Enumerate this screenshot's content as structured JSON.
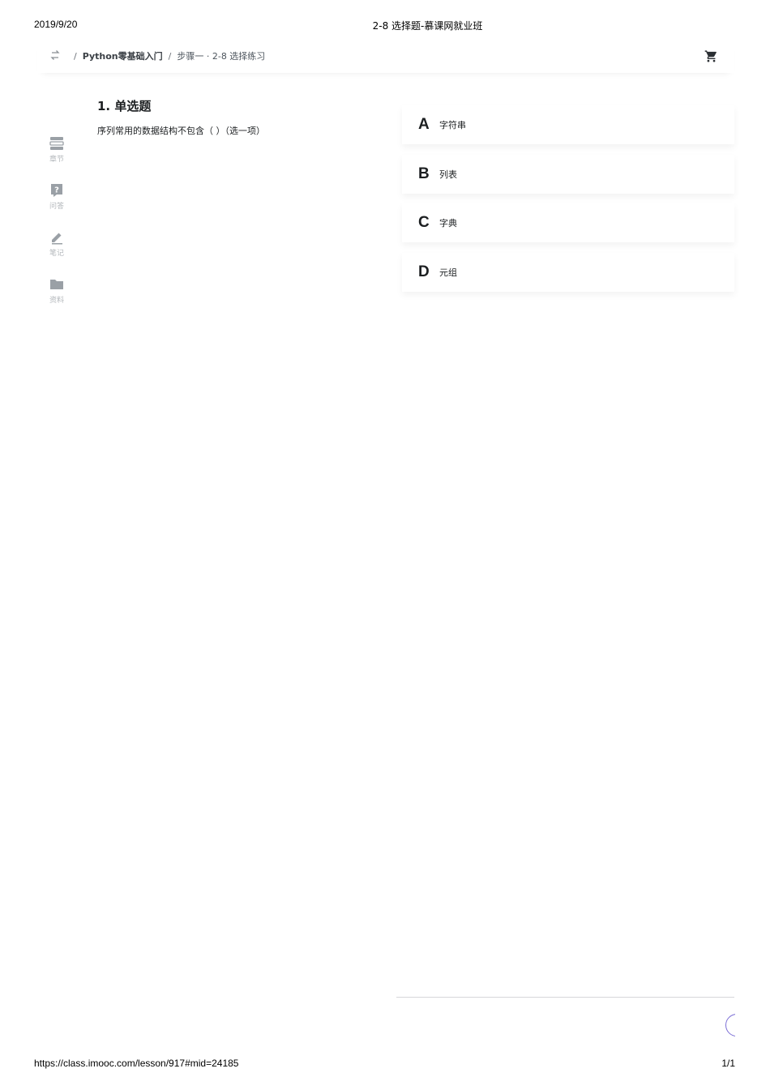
{
  "print": {
    "date": "2019/9/20",
    "title": "2-8 选择题-慕课网就业班",
    "url": "https://class.imooc.com/lesson/917#mid=24185",
    "page": "1/1"
  },
  "topbar": {
    "back_icon": "switch-arrows-icon",
    "breadcrumb": {
      "sep1": "/",
      "course": "Python零基础入门",
      "sep2": "/",
      "lesson": "步骤一 · 2-8 选择练习"
    },
    "cart_icon": "shopping-cart-icon"
  },
  "sidebar": {
    "items": [
      {
        "icon": "chapter-list-icon",
        "label": "章节"
      },
      {
        "icon": "question-icon",
        "label": "问答"
      },
      {
        "icon": "pencil-icon",
        "label": "笔记"
      },
      {
        "icon": "folder-icon",
        "label": "资料"
      }
    ]
  },
  "question": {
    "title": "1. 单选题",
    "text": "序列常用的数据结构不包含（ ）（选一项）"
  },
  "options": [
    {
      "letter": "A",
      "text": "字符串"
    },
    {
      "letter": "B",
      "text": "列表"
    },
    {
      "letter": "C",
      "text": "字典"
    },
    {
      "letter": "D",
      "text": "元组"
    }
  ],
  "colors": {
    "text": "#1c1f21",
    "icon_gray": "#9aa0a6",
    "accent": "#7c6fd6"
  }
}
